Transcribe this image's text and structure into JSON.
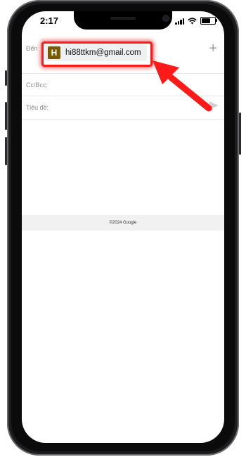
{
  "status_bar": {
    "time": "2:17"
  },
  "compose": {
    "to_label": "Đến",
    "to_chip": {
      "initial": "H",
      "email": "hi88ttkm@gmail.com",
      "avatar_color": "#7a5a00"
    },
    "add_icon": "plus-icon",
    "cc_label": "Cc/Bcc:",
    "subject_label": "Tiêu đề:"
  },
  "footer": {
    "text": "©2024 Google"
  },
  "annotation": {
    "highlight_color": "#ff1a1a",
    "arrow_icon": "red-arrow-icon"
  }
}
